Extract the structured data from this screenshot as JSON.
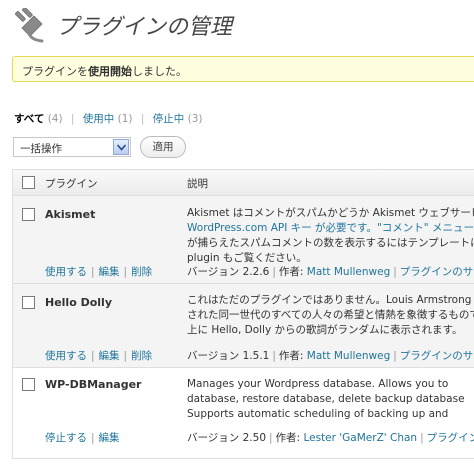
{
  "header": {
    "title": "プラグインの管理",
    "icon": "plugin-plug-icon"
  },
  "notice": {
    "before": "プラグインを",
    "bold": "使用開始",
    "after": "しました。"
  },
  "filters": {
    "all_label": "すべて",
    "all_count": "(4)",
    "active_label": "使用中",
    "active_count": "(1)",
    "inactive_label": "停止中",
    "inactive_count": "(3)"
  },
  "bulk": {
    "selected": "一括操作",
    "apply_label": "適用"
  },
  "table": {
    "col_plugin": "プラグイン",
    "col_desc": "説明",
    "rows": [
      {
        "name": "Akismet",
        "status": "inactive",
        "actions": [
          "使用する",
          "編集",
          "削除"
        ],
        "desc_lines": [
          "Akismet はコメントがスパムかどうか Akismet ウェブサービス",
          "WordPress.com API キー が必要です。\"コメント\" メニュー",
          "が捕らえたスパムコメントの数を表示するにはテンプレートに",
          "plugin もご覧ください。"
        ],
        "version": "バージョン 2.2.6",
        "author_label": "作者:",
        "author": "Matt Mullenweg",
        "site": "プラグインのサイト"
      },
      {
        "name": "Hello Dolly",
        "status": "inactive",
        "actions": [
          "使用する",
          "編集",
          "削除"
        ],
        "desc_lines": [
          "これはただのプラグインではありません。Louis Armstrong によって",
          "された同一世代のすべての人々の希望と情熱を象徴するものです",
          "上に Hello, Dolly からの歌詞がランダムに表示されます。"
        ],
        "version": "バージョン 1.5.1",
        "author_label": "作者:",
        "author": "Matt Mullenweg",
        "site": "プラグインのサイト"
      },
      {
        "name": "WP-DBManager",
        "status": "active",
        "actions": [
          "停止する",
          "編集"
        ],
        "desc_lines": [
          "Manages your Wordpress database. Allows you to",
          "database, restore database, delete backup database",
          "Supports automatic scheduling of backing up and"
        ],
        "version": "バージョン 2.50",
        "author_label": "作者:",
        "author": "Lester 'GaMerZ' Chan",
        "site": "プラグインのサイト"
      }
    ]
  }
}
